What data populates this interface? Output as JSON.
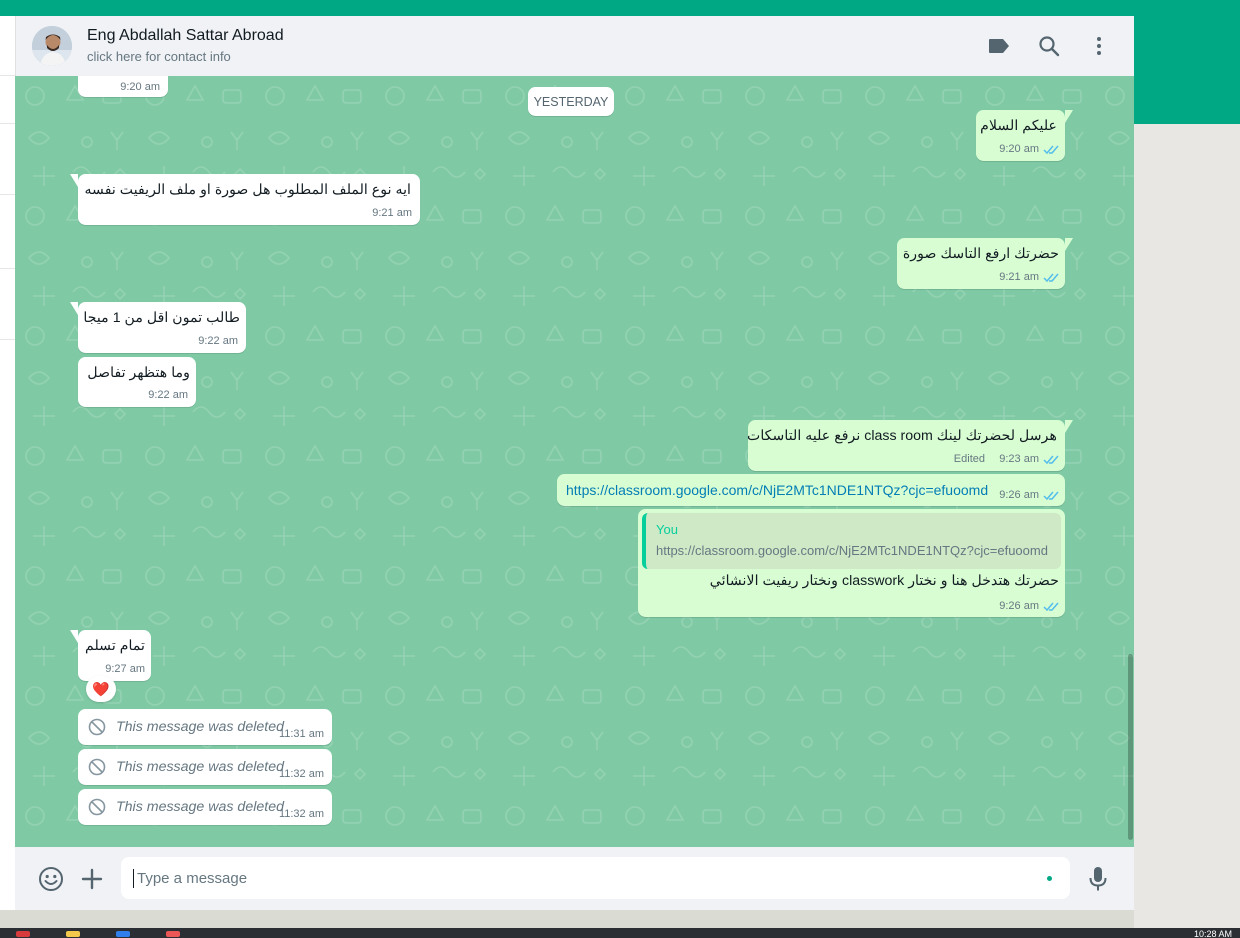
{
  "header": {
    "contact_name": "Eng Abdallah Sattar Abroad",
    "contact_sub": "click here for contact info",
    "icons": [
      "label-icon",
      "search-icon",
      "menu-icon"
    ]
  },
  "chat": {
    "date_chip": "YESTERDAY",
    "messages": [
      {
        "dir": "in",
        "time": "9:20 am"
      },
      {
        "dir": "out",
        "text": "عليكم السلام",
        "time": "9:20 am",
        "status": "read"
      },
      {
        "dir": "in",
        "text": "ايه نوع الملف المطلوب هل صورة او ملف الريفيت نفسه",
        "time": "9:21 am"
      },
      {
        "dir": "out",
        "text": "حضرتك ارفع التاسك صورة",
        "time": "9:21 am",
        "status": "read"
      },
      {
        "dir": "in",
        "text": "طالب تمون اقل من 1 ميجا",
        "time": "9:22 am"
      },
      {
        "dir": "in",
        "text": "وما هتظهر تفاصل",
        "time": "9:22 am"
      },
      {
        "dir": "out",
        "text": "هرسل لحضرتك لينك class room نرفع عليه التاسكات",
        "time": "9:23 am",
        "edited_label": "Edited",
        "status": "read"
      },
      {
        "dir": "out",
        "text": "https://classroom.google.com/c/NjE2MTc1NDE1NTQz?cjc=efuoomd",
        "time": "9:26 am",
        "status": "read",
        "is_link": true
      },
      {
        "dir": "out",
        "quote_name": "You",
        "quote_text": "https://classroom.google.com/c/NjE2MTc1NDE1NTQz?cjc=efuoomd",
        "text": "حضرتك هتدخل هنا و نختار classwork  ونختار ريفيت الانشائي",
        "time": "9:26 am",
        "status": "read"
      },
      {
        "dir": "in",
        "text": "تمام تسلم",
        "time": "9:27 am",
        "reaction": "❤️"
      },
      {
        "dir": "in",
        "text": "This message was deleted",
        "time": "11:31 am",
        "deleted": true
      },
      {
        "dir": "in",
        "text": "This message was deleted",
        "time": "11:32 am",
        "deleted": true
      },
      {
        "dir": "in",
        "text": "This message was deleted",
        "time": "11:32 am",
        "deleted": true
      }
    ]
  },
  "composer": {
    "placeholder": "Type a message",
    "icons": [
      "emoji-icon",
      "attach-plus-icon",
      "microphone-icon"
    ]
  },
  "taskbar": {
    "clock": "10:28 AM"
  },
  "colors": {
    "brand_teal": "#00a884",
    "chat_bg": "#7fcaa5",
    "outgoing_bubble": "#d9fdd3",
    "incoming_bubble": "#ffffff",
    "read_tick": "#53bdeb",
    "link": "#027eb5"
  }
}
